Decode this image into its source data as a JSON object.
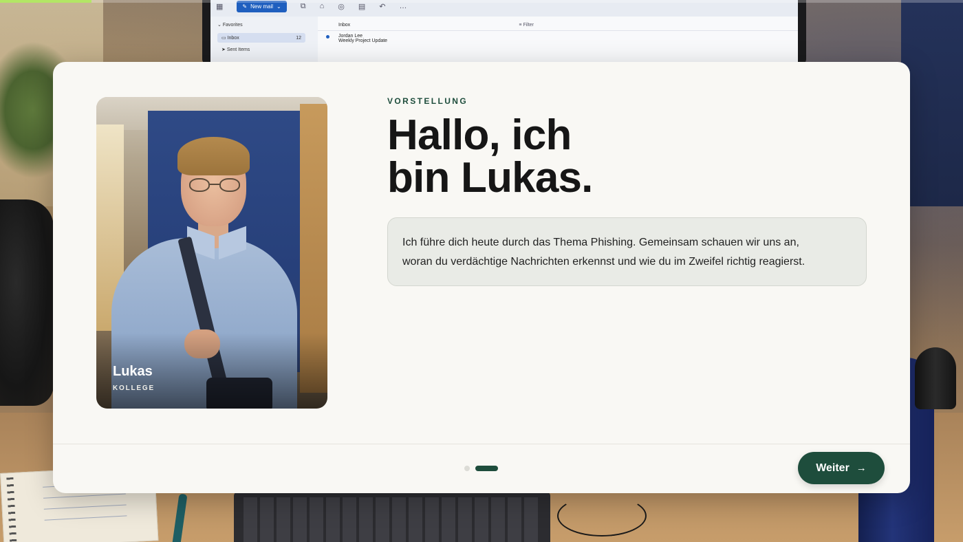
{
  "background": {
    "mail_app": {
      "new_mail_label": "New mail",
      "favorites_label": "Favorites",
      "folders": [
        {
          "label": "Inbox",
          "count": "12"
        },
        {
          "label": "Sent Items",
          "count": ""
        }
      ],
      "list_title": "Inbox",
      "filter_label": "Filter",
      "message": {
        "sender": "Jordan Lee",
        "subject": "Weekly Project Update"
      }
    }
  },
  "progress": {
    "fraction": 0.095,
    "color": "#b3e665"
  },
  "card": {
    "character": {
      "name": "Lukas",
      "role": "KOLLEGE"
    },
    "eyebrow": "VORSTELLUNG",
    "headline_line1": "Hallo, ich",
    "headline_line2": "bin Lukas.",
    "intro_line1": "Ich führe dich heute durch das Thema Phishing. Gemeinsam schauen wir uns an,",
    "intro_line2": "woran du verdächtige Nachrichten erkennst und wie du im Zweifel richtig reagierst.",
    "pagination": {
      "total": 2,
      "current": 2
    },
    "next_label": "Weiter",
    "next_icon": "arrow-right-icon",
    "accent_color": "#1e4d3c"
  }
}
